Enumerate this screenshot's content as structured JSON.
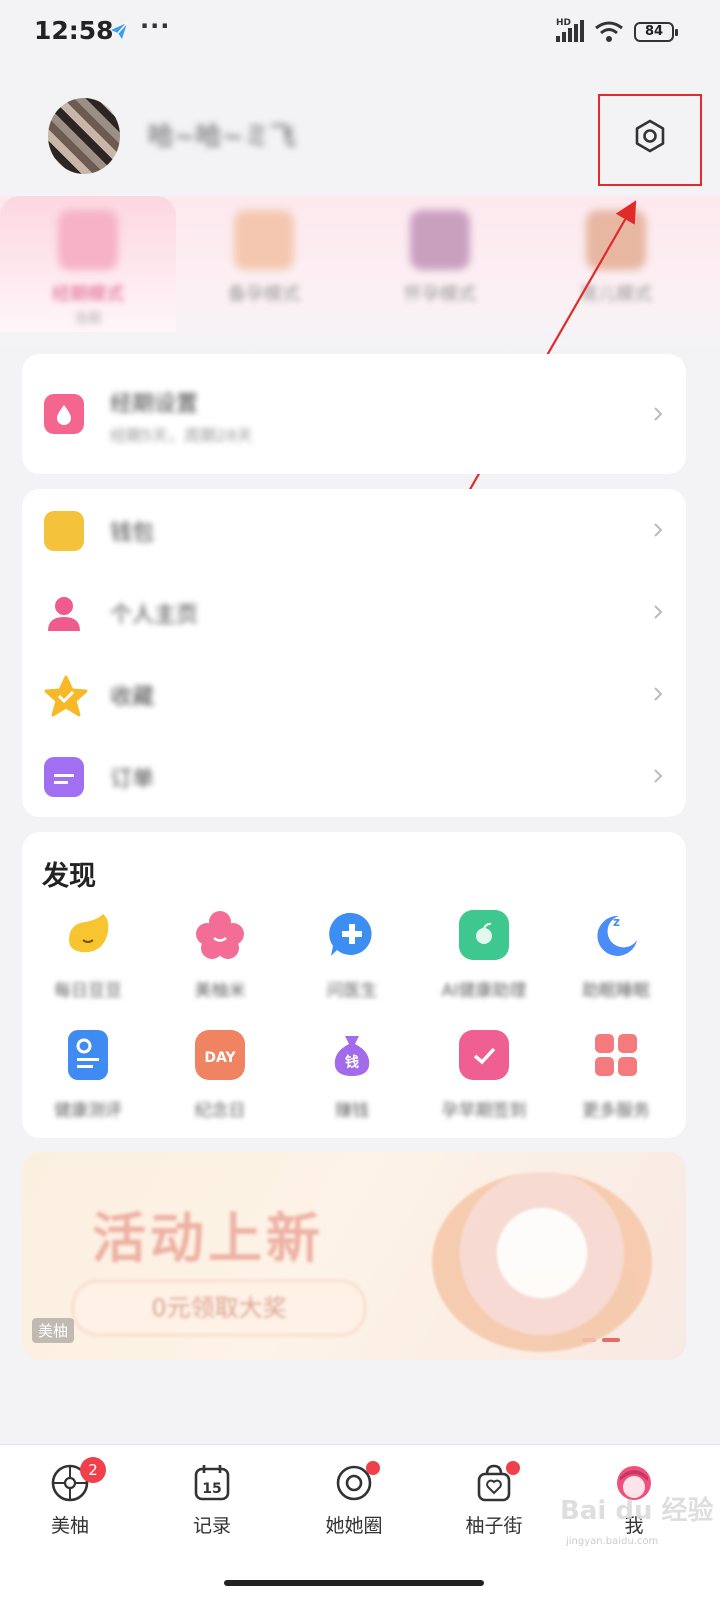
{
  "status_bar": {
    "time": "12:58",
    "more": "···",
    "hd": "HD",
    "battery": "84"
  },
  "profile": {
    "username": "哈~哈~ミ飞"
  },
  "modes": [
    {
      "label": "经期模式",
      "sub": "当前",
      "color": "#f6b2c6",
      "selected": true
    },
    {
      "label": "备孕模式",
      "sub": "",
      "color": "#f4c8b0",
      "selected": false
    },
    {
      "label": "怀孕模式",
      "sub": "",
      "color": "#caa0bf",
      "selected": false
    },
    {
      "label": "育儿模式",
      "sub": "",
      "color": "#e7b7a2",
      "selected": false
    }
  ],
  "period_card": {
    "title": "经期设置",
    "subtitle": "经期5天，周期28天",
    "icon": "calendar-drop-icon"
  },
  "menu": [
    {
      "label": "钱包",
      "icon": "wallet-icon",
      "color": "#f5c33b"
    },
    {
      "label": "个人主页",
      "icon": "person-icon",
      "color": "#ef5b8c"
    },
    {
      "label": "收藏",
      "icon": "star-icon",
      "color": "#f7b928"
    },
    {
      "label": "订单",
      "icon": "order-icon",
      "color": "#a26ef2"
    }
  ],
  "discover": {
    "title": "发现",
    "items": [
      {
        "label": "每日豆豆",
        "icon": "bean-icon",
        "color": "#f7c52f"
      },
      {
        "label": "美柚米",
        "icon": "flower-icon",
        "color": "#f46d97"
      },
      {
        "label": "问医生",
        "icon": "doctor-chat-icon",
        "color": "#3d8ef3"
      },
      {
        "label": "AI健康助理",
        "icon": "health-icon",
        "color": "#3ec78e"
      },
      {
        "label": "助眠睡眠",
        "icon": "moon-icon",
        "color": "#4b8df6"
      },
      {
        "label": "健康测评",
        "icon": "document-icon",
        "color": "#3f8bf2"
      },
      {
        "label": "纪念日",
        "icon": "day-calendar-icon",
        "color": "#f08462"
      },
      {
        "label": "赚钱",
        "icon": "money-bag-icon",
        "color": "#a36be9"
      },
      {
        "label": "孕早期签到",
        "icon": "check-calendar-icon",
        "color": "#f05f92"
      },
      {
        "label": "更多服务",
        "icon": "grid-icon",
        "color": "#f47a7e"
      }
    ]
  },
  "banner": {
    "title": "活动上新",
    "pill": "0元领取大奖",
    "tag": "美柚"
  },
  "bottom_nav": [
    {
      "label": "美柚",
      "icon": "meiyou-icon",
      "badge": "2"
    },
    {
      "label": "记录",
      "icon": "calendar-15-icon",
      "badge": ""
    },
    {
      "label": "她她圈",
      "icon": "circle-icon",
      "badge": "dot"
    },
    {
      "label": "柚子街",
      "icon": "shop-bag-icon",
      "badge": "dot"
    },
    {
      "label": "我",
      "icon": "me-icon",
      "badge": ""
    }
  ],
  "calendar_day": "15",
  "day_text": "DAY",
  "money_text": "钱",
  "watermark": "Bai du 经验",
  "watermark_sub": "jingyan.baidu.com"
}
